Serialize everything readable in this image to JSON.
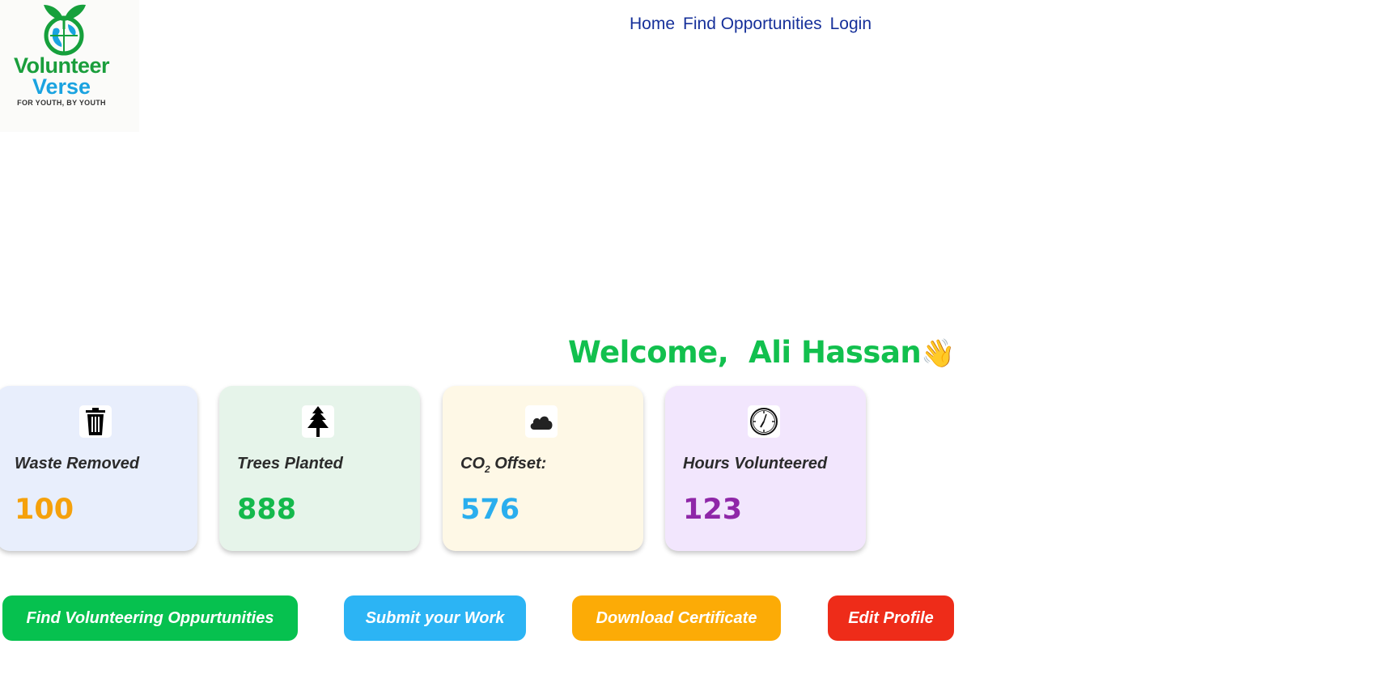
{
  "logo": {
    "word1": "Volunteer",
    "word2": "Verse",
    "tagline": "FOR YOUTH, BY YOUTH"
  },
  "nav": {
    "items": [
      "Home",
      "Find Opportunities",
      "Login"
    ]
  },
  "welcome": {
    "greeting": "Welcome,  Ali Hassan",
    "emoji": "👋"
  },
  "stats": [
    {
      "label": "Waste Removed",
      "value": "100",
      "icon": "trash-icon",
      "bg": "#e8eefc",
      "color": "#f5a10c"
    },
    {
      "label": "Trees Planted",
      "value": "888",
      "icon": "tree-icon",
      "bg": "#e6f4ea",
      "color": "#14b94c"
    },
    {
      "label_prefix": "CO",
      "label_sub": "2",
      "label_suffix": " Offset:",
      "value": "576",
      "icon": "cloud-icon",
      "bg": "#fef8e6",
      "color": "#2aaeee"
    },
    {
      "label": "Hours Volunteered",
      "value": "123",
      "icon": "clock-icon",
      "bg": "#f2e6fd",
      "color": "#8f27a8"
    }
  ],
  "buttons": [
    {
      "label": "Find Volunteering Oppurtunities",
      "color": "#06c14f"
    },
    {
      "label": "Submit your Work",
      "color": "#2cb4f4"
    },
    {
      "label": "Download Certificate",
      "color": "#fcab06"
    },
    {
      "label": "Edit Profile",
      "color": "#ee2c19"
    }
  ]
}
